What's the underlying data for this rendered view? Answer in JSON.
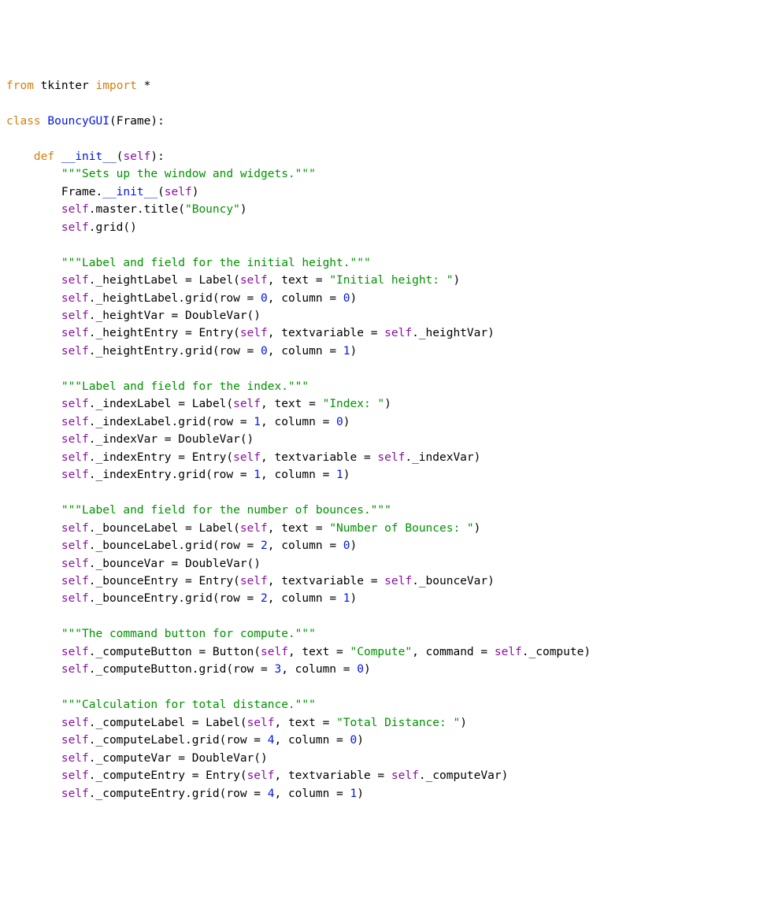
{
  "tokens": [
    {
      "t": "from",
      "c": "kw-orange"
    },
    {
      "t": " ",
      "c": "kw-black"
    },
    {
      "t": "tkinter",
      "c": "kw-black"
    },
    {
      "t": " ",
      "c": "kw-black"
    },
    {
      "t": "import",
      "c": "kw-orange"
    },
    {
      "t": " ",
      "c": "kw-black"
    },
    {
      "t": "*",
      "c": "kw-black"
    },
    {
      "t": "\n",
      "c": ""
    },
    {
      "t": "\n",
      "c": ""
    },
    {
      "t": "class",
      "c": "kw-orange"
    },
    {
      "t": " ",
      "c": ""
    },
    {
      "t": "BouncyGUI",
      "c": "kw-blue"
    },
    {
      "t": "(Frame):",
      "c": "kw-black"
    },
    {
      "t": "\n",
      "c": ""
    },
    {
      "t": "\n",
      "c": ""
    },
    {
      "t": "    ",
      "c": ""
    },
    {
      "t": "def",
      "c": "kw-orange"
    },
    {
      "t": " ",
      "c": ""
    },
    {
      "t": "__init__",
      "c": "kw-blue"
    },
    {
      "t": "(",
      "c": "kw-black"
    },
    {
      "t": "self",
      "c": "kw-purple"
    },
    {
      "t": "):",
      "c": "kw-black"
    },
    {
      "t": "\n",
      "c": ""
    },
    {
      "t": "        ",
      "c": ""
    },
    {
      "t": "\"\"\"Sets up the window and widgets.\"\"\"",
      "c": "kw-green"
    },
    {
      "t": "\n",
      "c": ""
    },
    {
      "t": "        Frame.",
      "c": "kw-black"
    },
    {
      "t": "__init__",
      "c": "kw-blue"
    },
    {
      "t": "(",
      "c": "kw-black"
    },
    {
      "t": "self",
      "c": "kw-purple"
    },
    {
      "t": ")",
      "c": "kw-black"
    },
    {
      "t": "\n",
      "c": ""
    },
    {
      "t": "        ",
      "c": ""
    },
    {
      "t": "self",
      "c": "kw-purple"
    },
    {
      "t": ".master.title(",
      "c": "kw-black"
    },
    {
      "t": "\"Bouncy\"",
      "c": "kw-green"
    },
    {
      "t": ")",
      "c": "kw-black"
    },
    {
      "t": "\n",
      "c": ""
    },
    {
      "t": "        ",
      "c": ""
    },
    {
      "t": "self",
      "c": "kw-purple"
    },
    {
      "t": ".grid()",
      "c": "kw-black"
    },
    {
      "t": "\n",
      "c": ""
    },
    {
      "t": "\n",
      "c": ""
    },
    {
      "t": "        ",
      "c": ""
    },
    {
      "t": "\"\"\"Label and field for the initial height.\"\"\"",
      "c": "kw-green"
    },
    {
      "t": "\n",
      "c": ""
    },
    {
      "t": "        ",
      "c": ""
    },
    {
      "t": "self",
      "c": "kw-purple"
    },
    {
      "t": "._heightLabel = Label(",
      "c": "kw-black"
    },
    {
      "t": "self",
      "c": "kw-purple"
    },
    {
      "t": ", text = ",
      "c": "kw-black"
    },
    {
      "t": "\"Initial height: \"",
      "c": "kw-green"
    },
    {
      "t": ")",
      "c": "kw-black"
    },
    {
      "t": "\n",
      "c": ""
    },
    {
      "t": "        ",
      "c": ""
    },
    {
      "t": "self",
      "c": "kw-purple"
    },
    {
      "t": "._heightLabel.grid(row = ",
      "c": "kw-black"
    },
    {
      "t": "0",
      "c": "kw-blue"
    },
    {
      "t": ", column = ",
      "c": "kw-black"
    },
    {
      "t": "0",
      "c": "kw-blue"
    },
    {
      "t": ")",
      "c": "kw-black"
    },
    {
      "t": "\n",
      "c": ""
    },
    {
      "t": "        ",
      "c": ""
    },
    {
      "t": "self",
      "c": "kw-purple"
    },
    {
      "t": "._heightVar = DoubleVar()",
      "c": "kw-black"
    },
    {
      "t": "\n",
      "c": ""
    },
    {
      "t": "        ",
      "c": ""
    },
    {
      "t": "self",
      "c": "kw-purple"
    },
    {
      "t": "._heightEntry = Entry(",
      "c": "kw-black"
    },
    {
      "t": "self",
      "c": "kw-purple"
    },
    {
      "t": ", textvariable = ",
      "c": "kw-black"
    },
    {
      "t": "self",
      "c": "kw-purple"
    },
    {
      "t": "._heightVar)",
      "c": "kw-black"
    },
    {
      "t": "\n",
      "c": ""
    },
    {
      "t": "        ",
      "c": ""
    },
    {
      "t": "self",
      "c": "kw-purple"
    },
    {
      "t": "._heightEntry.grid(row = ",
      "c": "kw-black"
    },
    {
      "t": "0",
      "c": "kw-blue"
    },
    {
      "t": ", column = ",
      "c": "kw-black"
    },
    {
      "t": "1",
      "c": "kw-blue"
    },
    {
      "t": ")",
      "c": "kw-black"
    },
    {
      "t": "\n",
      "c": ""
    },
    {
      "t": "\n",
      "c": ""
    },
    {
      "t": "        ",
      "c": ""
    },
    {
      "t": "\"\"\"Label and field for the index.\"\"\"",
      "c": "kw-green"
    },
    {
      "t": "\n",
      "c": ""
    },
    {
      "t": "        ",
      "c": ""
    },
    {
      "t": "self",
      "c": "kw-purple"
    },
    {
      "t": "._indexLabel = Label(",
      "c": "kw-black"
    },
    {
      "t": "self",
      "c": "kw-purple"
    },
    {
      "t": ", text = ",
      "c": "kw-black"
    },
    {
      "t": "\"Index: \"",
      "c": "kw-green"
    },
    {
      "t": ")",
      "c": "kw-black"
    },
    {
      "t": "\n",
      "c": ""
    },
    {
      "t": "        ",
      "c": ""
    },
    {
      "t": "self",
      "c": "kw-purple"
    },
    {
      "t": "._indexLabel.grid(row = ",
      "c": "kw-black"
    },
    {
      "t": "1",
      "c": "kw-blue"
    },
    {
      "t": ", column = ",
      "c": "kw-black"
    },
    {
      "t": "0",
      "c": "kw-blue"
    },
    {
      "t": ")",
      "c": "kw-black"
    },
    {
      "t": "\n",
      "c": ""
    },
    {
      "t": "        ",
      "c": ""
    },
    {
      "t": "self",
      "c": "kw-purple"
    },
    {
      "t": "._indexVar = DoubleVar()",
      "c": "kw-black"
    },
    {
      "t": "\n",
      "c": ""
    },
    {
      "t": "        ",
      "c": ""
    },
    {
      "t": "self",
      "c": "kw-purple"
    },
    {
      "t": "._indexEntry = Entry(",
      "c": "kw-black"
    },
    {
      "t": "self",
      "c": "kw-purple"
    },
    {
      "t": ", textvariable = ",
      "c": "kw-black"
    },
    {
      "t": "self",
      "c": "kw-purple"
    },
    {
      "t": "._indexVar)",
      "c": "kw-black"
    },
    {
      "t": "\n",
      "c": ""
    },
    {
      "t": "        ",
      "c": ""
    },
    {
      "t": "self",
      "c": "kw-purple"
    },
    {
      "t": "._indexEntry.grid(row = ",
      "c": "kw-black"
    },
    {
      "t": "1",
      "c": "kw-blue"
    },
    {
      "t": ", column = ",
      "c": "kw-black"
    },
    {
      "t": "1",
      "c": "kw-blue"
    },
    {
      "t": ")",
      "c": "kw-black"
    },
    {
      "t": "\n",
      "c": ""
    },
    {
      "t": "\n",
      "c": ""
    },
    {
      "t": "        ",
      "c": ""
    },
    {
      "t": "\"\"\"Label and field for the number of bounces.\"\"\"",
      "c": "kw-green"
    },
    {
      "t": "\n",
      "c": ""
    },
    {
      "t": "        ",
      "c": ""
    },
    {
      "t": "self",
      "c": "kw-purple"
    },
    {
      "t": "._bounceLabel = Label(",
      "c": "kw-black"
    },
    {
      "t": "self",
      "c": "kw-purple"
    },
    {
      "t": ", text = ",
      "c": "kw-black"
    },
    {
      "t": "\"Number of Bounces: \"",
      "c": "kw-green"
    },
    {
      "t": ")",
      "c": "kw-black"
    },
    {
      "t": "\n",
      "c": ""
    },
    {
      "t": "        ",
      "c": ""
    },
    {
      "t": "self",
      "c": "kw-purple"
    },
    {
      "t": "._bounceLabel.grid(row = ",
      "c": "kw-black"
    },
    {
      "t": "2",
      "c": "kw-blue"
    },
    {
      "t": ", column = ",
      "c": "kw-black"
    },
    {
      "t": "0",
      "c": "kw-blue"
    },
    {
      "t": ")",
      "c": "kw-black"
    },
    {
      "t": "\n",
      "c": ""
    },
    {
      "t": "        ",
      "c": ""
    },
    {
      "t": "self",
      "c": "kw-purple"
    },
    {
      "t": "._bounceVar = DoubleVar()",
      "c": "kw-black"
    },
    {
      "t": "\n",
      "c": ""
    },
    {
      "t": "        ",
      "c": ""
    },
    {
      "t": "self",
      "c": "kw-purple"
    },
    {
      "t": "._bounceEntry = Entry(",
      "c": "kw-black"
    },
    {
      "t": "self",
      "c": "kw-purple"
    },
    {
      "t": ", textvariable = ",
      "c": "kw-black"
    },
    {
      "t": "self",
      "c": "kw-purple"
    },
    {
      "t": "._bounceVar)",
      "c": "kw-black"
    },
    {
      "t": "\n",
      "c": ""
    },
    {
      "t": "        ",
      "c": ""
    },
    {
      "t": "self",
      "c": "kw-purple"
    },
    {
      "t": "._bounceEntry.grid(row = ",
      "c": "kw-black"
    },
    {
      "t": "2",
      "c": "kw-blue"
    },
    {
      "t": ", column = ",
      "c": "kw-black"
    },
    {
      "t": "1",
      "c": "kw-blue"
    },
    {
      "t": ")",
      "c": "kw-black"
    },
    {
      "t": "\n",
      "c": ""
    },
    {
      "t": "\n",
      "c": ""
    },
    {
      "t": "        ",
      "c": ""
    },
    {
      "t": "\"\"\"The command button for compute.\"\"\"",
      "c": "kw-green"
    },
    {
      "t": "\n",
      "c": ""
    },
    {
      "t": "        ",
      "c": ""
    },
    {
      "t": "self",
      "c": "kw-purple"
    },
    {
      "t": "._computeButton = Button(",
      "c": "kw-black"
    },
    {
      "t": "self",
      "c": "kw-purple"
    },
    {
      "t": ", text = ",
      "c": "kw-black"
    },
    {
      "t": "\"Compute\"",
      "c": "kw-green"
    },
    {
      "t": ", command = ",
      "c": "kw-black"
    },
    {
      "t": "self",
      "c": "kw-purple"
    },
    {
      "t": "._compute)",
      "c": "kw-black"
    },
    {
      "t": "\n",
      "c": ""
    },
    {
      "t": "        ",
      "c": ""
    },
    {
      "t": "self",
      "c": "kw-purple"
    },
    {
      "t": "._computeButton.grid(row = ",
      "c": "kw-black"
    },
    {
      "t": "3",
      "c": "kw-blue"
    },
    {
      "t": ", column = ",
      "c": "kw-black"
    },
    {
      "t": "0",
      "c": "kw-blue"
    },
    {
      "t": ")",
      "c": "kw-black"
    },
    {
      "t": "\n",
      "c": ""
    },
    {
      "t": "\n",
      "c": ""
    },
    {
      "t": "        ",
      "c": ""
    },
    {
      "t": "\"\"\"Calculation for total distance.\"\"\"",
      "c": "kw-green"
    },
    {
      "t": "\n",
      "c": ""
    },
    {
      "t": "        ",
      "c": ""
    },
    {
      "t": "self",
      "c": "kw-purple"
    },
    {
      "t": "._computeLabel = Label(",
      "c": "kw-black"
    },
    {
      "t": "self",
      "c": "kw-purple"
    },
    {
      "t": ", text = ",
      "c": "kw-black"
    },
    {
      "t": "\"Total Distance: \"",
      "c": "kw-green"
    },
    {
      "t": ")",
      "c": "kw-black"
    },
    {
      "t": "\n",
      "c": ""
    },
    {
      "t": "        ",
      "c": ""
    },
    {
      "t": "self",
      "c": "kw-purple"
    },
    {
      "t": "._computeLabel.grid(row = ",
      "c": "kw-black"
    },
    {
      "t": "4",
      "c": "kw-blue"
    },
    {
      "t": ", column = ",
      "c": "kw-black"
    },
    {
      "t": "0",
      "c": "kw-blue"
    },
    {
      "t": ")",
      "c": "kw-black"
    },
    {
      "t": "\n",
      "c": ""
    },
    {
      "t": "        ",
      "c": ""
    },
    {
      "t": "self",
      "c": "kw-purple"
    },
    {
      "t": "._computeVar = DoubleVar()",
      "c": "kw-black"
    },
    {
      "t": "\n",
      "c": ""
    },
    {
      "t": "        ",
      "c": ""
    },
    {
      "t": "self",
      "c": "kw-purple"
    },
    {
      "t": "._computeEntry = Entry(",
      "c": "kw-black"
    },
    {
      "t": "self",
      "c": "kw-purple"
    },
    {
      "t": ", textvariable = ",
      "c": "kw-black"
    },
    {
      "t": "self",
      "c": "kw-purple"
    },
    {
      "t": "._computeVar)",
      "c": "kw-black"
    },
    {
      "t": "\n",
      "c": ""
    },
    {
      "t": "        ",
      "c": ""
    },
    {
      "t": "self",
      "c": "kw-purple"
    },
    {
      "t": "._computeEntry.grid(row = ",
      "c": "kw-black"
    },
    {
      "t": "4",
      "c": "kw-blue"
    },
    {
      "t": ", column = ",
      "c": "kw-black"
    },
    {
      "t": "1",
      "c": "kw-blue"
    },
    {
      "t": ")",
      "c": "kw-black"
    },
    {
      "t": "\n",
      "c": ""
    }
  ]
}
